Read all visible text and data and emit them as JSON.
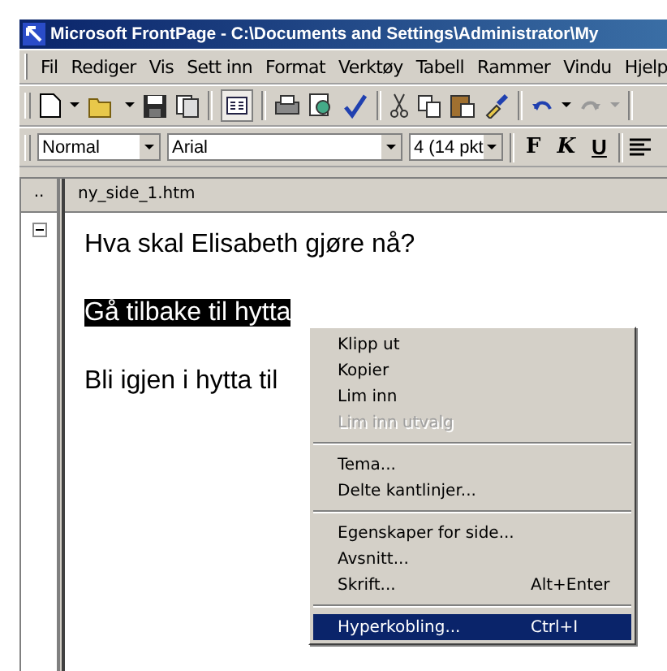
{
  "window": {
    "title": "Microsoft FrontPage - C:\\Documents and Settings\\Administrator\\My"
  },
  "menu_bar": [
    "Fil",
    "Rediger",
    "Vis",
    "Sett inn",
    "Format",
    "Verktøy",
    "Tabell",
    "Rammer",
    "Vindu",
    "Hjelp"
  ],
  "format_bar": {
    "style": "Normal",
    "font": "Arial",
    "size": "4  (14 pkt",
    "buttons": [
      {
        "label": "F",
        "kind": "bold"
      },
      {
        "label": "K",
        "kind": "italic"
      },
      {
        "label": "U",
        "kind": "underline"
      }
    ]
  },
  "folder_list": {
    "header": ".."
  },
  "document": {
    "tab": "ny_side_1.htm",
    "paragraphs": [
      {
        "text": "Hva skal Elisabeth gjøre nå?",
        "selected": false
      },
      {
        "text": "Gå tilbake til hytta",
        "selected": true
      },
      {
        "text": "Bli igjen i hytta til",
        "selected": false
      }
    ]
  },
  "context_menu": {
    "groups": [
      [
        {
          "label": "Klipp ut",
          "disabled": false,
          "selected": false
        },
        {
          "label": "Kopier",
          "disabled": false,
          "selected": false
        },
        {
          "label": "Lim inn",
          "disabled": false,
          "selected": false
        },
        {
          "label": "Lim inn utvalg",
          "disabled": true,
          "selected": false
        }
      ],
      [
        {
          "label": "Tema...",
          "disabled": false,
          "selected": false
        },
        {
          "label": "Delte kantlinjer...",
          "disabled": false,
          "selected": false
        }
      ],
      [
        {
          "label": "Egenskaper for side...",
          "disabled": false,
          "selected": false
        },
        {
          "label": "Avsnitt...",
          "disabled": false,
          "selected": false
        },
        {
          "label": "Skrift...",
          "shortcut": "Alt+Enter",
          "disabled": false,
          "selected": false
        }
      ],
      [
        {
          "label": "Hyperkobling...",
          "shortcut": "Ctrl+I",
          "disabled": false,
          "selected": true
        }
      ]
    ]
  }
}
